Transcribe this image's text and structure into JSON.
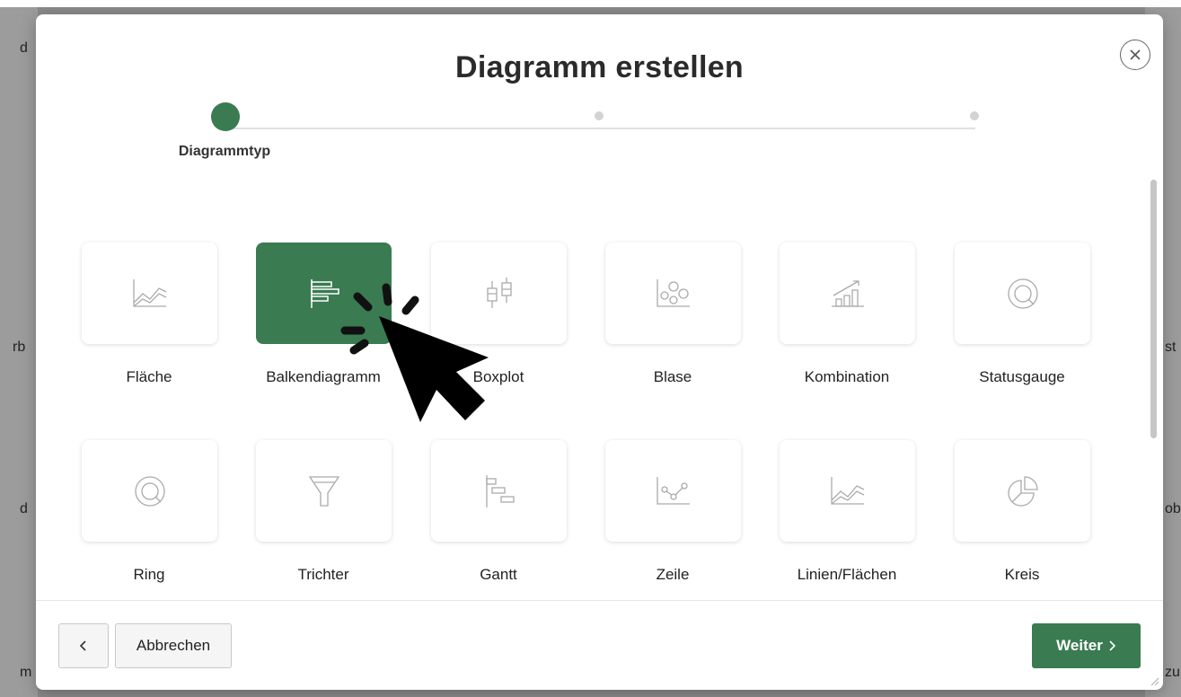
{
  "background": {
    "left_fragments": [
      "d",
      "rb",
      "d",
      "m"
    ],
    "right_fragments": [
      "st",
      "ob",
      "zu"
    ]
  },
  "dialog": {
    "title": "Diagramm erstellen",
    "close_icon": "close-icon",
    "steps": [
      {
        "label": "Diagrammtyp",
        "state": "active"
      },
      {
        "label": "",
        "state": "pending"
      },
      {
        "label": "",
        "state": "pending"
      }
    ],
    "chart_types": [
      {
        "label": "Fläche",
        "icon": "area-chart-icon",
        "selected": false
      },
      {
        "label": "Balkendiagramm",
        "icon": "bar-chart-icon",
        "selected": true
      },
      {
        "label": "Boxplot",
        "icon": "boxplot-icon",
        "selected": false
      },
      {
        "label": "Blase",
        "icon": "bubble-chart-icon",
        "selected": false
      },
      {
        "label": "Kombination",
        "icon": "combination-chart-icon",
        "selected": false
      },
      {
        "label": "Statusgauge",
        "icon": "status-gauge-icon",
        "selected": false
      },
      {
        "label": "Ring",
        "icon": "ring-chart-icon",
        "selected": false
      },
      {
        "label": "Trichter",
        "icon": "funnel-chart-icon",
        "selected": false
      },
      {
        "label": "Gantt",
        "icon": "gantt-chart-icon",
        "selected": false
      },
      {
        "label": "Zeile",
        "icon": "line-chart-icon",
        "selected": false
      },
      {
        "label": "Linien/Flächen",
        "icon": "line-area-chart-icon",
        "selected": false
      },
      {
        "label": "Kreis",
        "icon": "pie-chart-icon",
        "selected": false
      }
    ],
    "footer": {
      "back_icon": "chevron-left-icon",
      "cancel_label": "Abbrechen",
      "next_label": "Weiter",
      "next_icon": "chevron-right-icon"
    }
  },
  "colors": {
    "accent": "#3a7b52",
    "overlay": "#8a8a8a"
  }
}
